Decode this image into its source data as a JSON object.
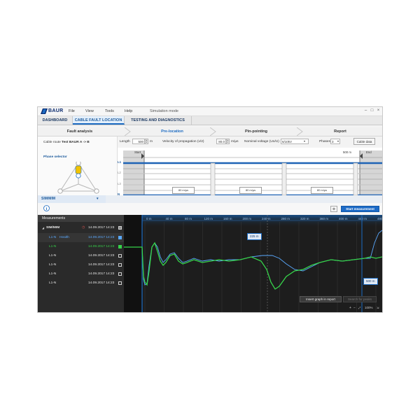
{
  "menu": {
    "logo": "BAUR",
    "items": [
      "File",
      "View",
      "Tools",
      "Help"
    ],
    "mode": "Simulation mode"
  },
  "tabs": [
    "DASHBOARD",
    "CABLE FAULT LOCATION",
    "TESTING AND DIAGNOSTICS"
  ],
  "steps": [
    "Fault analysis",
    "Pre-location",
    "Pin-pointing",
    "Report"
  ],
  "left_panel": {
    "cable_route_label": "Cable route",
    "cable_route_value": "Test BAUR A -> B",
    "phase_selector_label": "Phase selector",
    "phase_labels": [
      "L1",
      "L2",
      "L3",
      "N"
    ]
  },
  "controls": {
    "length_label": "Length",
    "length_value": "500",
    "length_unit": "m",
    "vop_label": "Velocity of propagation (v/2)",
    "vop_value": "80.0",
    "vop_unit": "m/µs",
    "voltage_label": "Nominal voltage (Uo/U)",
    "voltage_value": "6/10kV",
    "phases_label": "Phases",
    "phases_value": "3",
    "cable_data_button": "Cable data"
  },
  "ruler": {
    "start_label": "Start",
    "end_label": "End",
    "end_distance": "500 m",
    "rows": [
      "L1",
      "L2",
      "L3",
      "N"
    ],
    "speed_labels": [
      "80 m/µs",
      "80 m/µs",
      "80 m/µs"
    ]
  },
  "sim_tab": "SIM/MIM",
  "start_measurement_button": "Start measurement",
  "measurements": {
    "header": "Measurements",
    "group": "SIM/MIM",
    "group_date": "14.09.2017 14:23",
    "rows": [
      {
        "label": "L1-N",
        "tag": "Health",
        "date": "14.09.2017 14:23",
        "color": "#5aa9ff",
        "checked": true
      },
      {
        "label": "L1-N",
        "tag": "",
        "date": "14.09.2017 14:23",
        "color": "#36d34a",
        "checked": true
      },
      {
        "label": "L1-N",
        "tag": "",
        "date": "14.09.2017 14:23",
        "color": "#e6e6e6",
        "checked": false
      },
      {
        "label": "L1-N",
        "tag": "",
        "date": "14.09.2017 14:23",
        "color": "#e6e6e6",
        "checked": false
      },
      {
        "label": "L1-N",
        "tag": "",
        "date": "14.09.2017 14:23",
        "color": "#e6e6e6",
        "checked": false
      },
      {
        "label": "L1-N",
        "tag": "",
        "date": "14.09.2017 14:23",
        "color": "#e6e6e6",
        "checked": false
      }
    ]
  },
  "plot": {
    "ticks": [
      "0 m",
      "40 m",
      "80 m",
      "120 m",
      "160 m",
      "200 m",
      "240 m",
      "280 m",
      "320 m",
      "360 m",
      "400 m",
      "440 m",
      "480 m",
      "520 m"
    ],
    "cursor1": "225 m",
    "cursor2": "500 m",
    "insert_button": "Insert graph in report",
    "search_button": "Search for peaks",
    "zoom": "100%"
  },
  "colors": {
    "accent": "#1c6bc2",
    "trace_green": "#36d34a",
    "trace_blue": "#5aa9ff",
    "plot_bg": "#1d1d1d"
  }
}
